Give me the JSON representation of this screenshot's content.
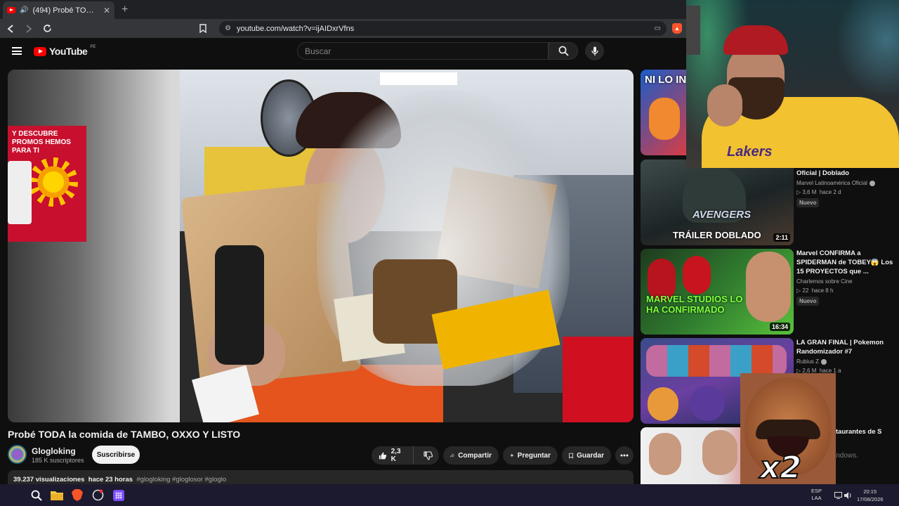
{
  "browser": {
    "tab_title": "(494) Probé TODA la comida d...",
    "tab_close": "✕",
    "new_tab": "+",
    "url": "youtube.com/watch?v=ijAIDxrVfns"
  },
  "youtube": {
    "logo_text": "YouTube",
    "country": "PE",
    "search_placeholder": "Buscar"
  },
  "video": {
    "title": "Probé TODA la comida de TAMBO, OXXO Y LISTO",
    "channel": "Glogloking",
    "subscribers": "185 K suscriptores",
    "subscribe_label": "Suscribirse",
    "likes": "2,3 K",
    "share_label": "Compartir",
    "ask_label": "Preguntar",
    "save_label": "Guardar",
    "views": "39.237 visualizaciones",
    "age": "hace 23 horas",
    "tags": "#glogloking #gloglosor #gloglo"
  },
  "scene_text": {
    "promo": "Y DESCUBRE PROMOS HEMOS PARA TI"
  },
  "recommendations": [
    {
      "thumb_text": "NI LO IN",
      "title": "",
      "channel": "",
      "meta": "",
      "duration": ""
    },
    {
      "thumb_text": "TRÁILER DOBLADO",
      "thumb_text2": "AVENGERS",
      "title": "Oficial | Doblado",
      "channel": "Marvel Latinoamérica Oficial",
      "views": "3,6 M",
      "age": "hace 2 d",
      "badge": "Nuevo",
      "duration": "2:11"
    },
    {
      "thumb_text": "MARVEL STUDIOS LO HA CONFIRMADO",
      "title": "Marvel CONFIRMA a SPIDERMAN de TOBEY😱 Los 15 PROYECTOS que ...",
      "channel": "Charlemos sobre Cine",
      "views": "22",
      "age": "hace 8 h",
      "badge": "Nuevo",
      "duration": "16:34"
    },
    {
      "title": "LA GRAN FINAL | Pokemon Randomizador #7",
      "channel": "Rubius Z",
      "views": "2,6 M",
      "age": "hace 1 a"
    },
    {
      "title": "taurantes de S"
    }
  ],
  "overlays": {
    "webcam_shirt_text": "Lakers",
    "meme_text": "x2",
    "windows_watermark": "indows."
  },
  "taskbar": {
    "lang_line1": "ESP",
    "lang_line2": "LAA",
    "time": "20:15",
    "date": "17/08/2026"
  },
  "colors": {
    "yt_red": "#ff0000",
    "bg": "#0f0f0f",
    "chip": "#272727"
  }
}
